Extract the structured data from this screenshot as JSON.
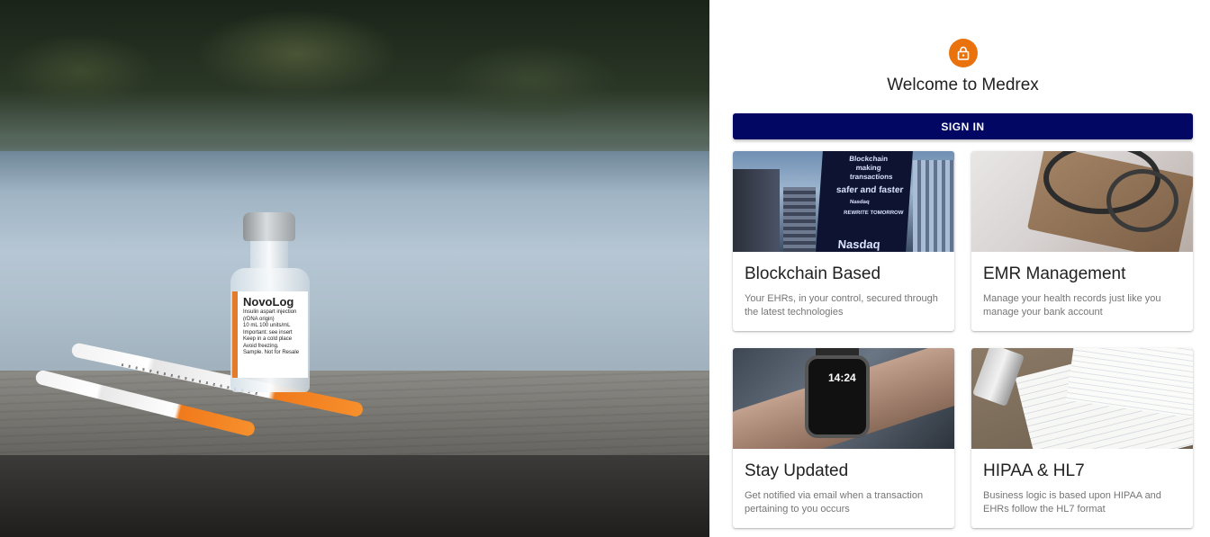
{
  "hero": {
    "vial_brand": "NovoLog",
    "vial_lines": [
      "Insulin aspart injection",
      "(rDNA origin)",
      "10 mL  100 units/mL",
      "Important: see insert",
      "Keep in a cold place",
      "Avoid freezing.",
      "Sample. Not for Resale"
    ]
  },
  "auth": {
    "icon": "lock-icon",
    "welcome": "Welcome to Medrex",
    "signin_label": "SIGN IN",
    "accent_color": "#e9720c",
    "button_color": "#020764"
  },
  "cards": [
    {
      "title": "Blockchain Based",
      "description": "Your EHRs, in your control, secured through the latest technologies",
      "image_text": [
        "Blockchain",
        "making",
        "transactions",
        "safer and faster",
        "Nasdaq",
        "REWRITE TOMORROW",
        "Nasdaq"
      ]
    },
    {
      "title": "EMR Management",
      "description": "Manage your health records just like you manage your bank account"
    },
    {
      "title": "Stay Updated",
      "description": "Get notified via email when a transaction pertaining to you occurs",
      "image_text": [
        "14:24"
      ]
    },
    {
      "title": "HIPAA & HL7",
      "description": "Business logic is based upon HIPAA and EHRs follow the HL7 format"
    }
  ]
}
